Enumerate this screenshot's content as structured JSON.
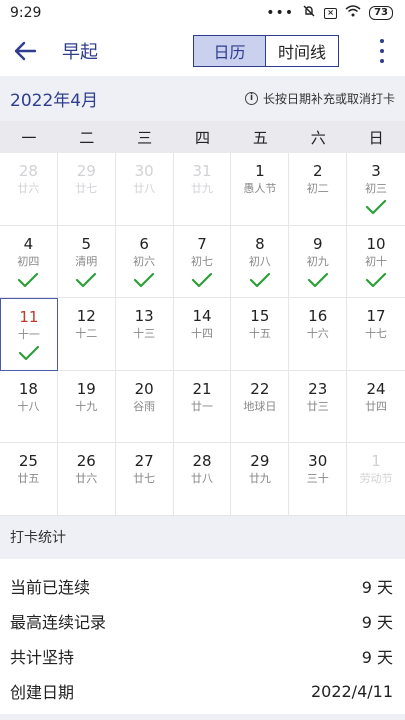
{
  "status": {
    "time": "9:29",
    "battery": "73"
  },
  "toolbar": {
    "title": "早起",
    "tab_calendar": "日历",
    "tab_timeline": "时间线"
  },
  "month": {
    "label": "2022年4月",
    "hint": "长按日期补充或取消打卡"
  },
  "weekdays": [
    "一",
    "二",
    "三",
    "四",
    "五",
    "六",
    "日"
  ],
  "days": [
    {
      "d": "28",
      "l": "廿六",
      "muted": true
    },
    {
      "d": "29",
      "l": "廿七",
      "muted": true
    },
    {
      "d": "30",
      "l": "廿八",
      "muted": true
    },
    {
      "d": "31",
      "l": "廿九",
      "muted": true
    },
    {
      "d": "1",
      "l": "愚人节"
    },
    {
      "d": "2",
      "l": "初二"
    },
    {
      "d": "3",
      "l": "初三",
      "checked": true
    },
    {
      "d": "4",
      "l": "初四",
      "checked": true
    },
    {
      "d": "5",
      "l": "清明",
      "checked": true
    },
    {
      "d": "6",
      "l": "初六",
      "checked": true
    },
    {
      "d": "7",
      "l": "初七",
      "checked": true
    },
    {
      "d": "8",
      "l": "初八",
      "checked": true
    },
    {
      "d": "9",
      "l": "初九",
      "checked": true
    },
    {
      "d": "10",
      "l": "初十",
      "checked": true
    },
    {
      "d": "11",
      "l": "十一",
      "checked": true,
      "today": true
    },
    {
      "d": "12",
      "l": "十二"
    },
    {
      "d": "13",
      "l": "十三"
    },
    {
      "d": "14",
      "l": "十四"
    },
    {
      "d": "15",
      "l": "十五"
    },
    {
      "d": "16",
      "l": "十六"
    },
    {
      "d": "17",
      "l": "十七"
    },
    {
      "d": "18",
      "l": "十八"
    },
    {
      "d": "19",
      "l": "十九"
    },
    {
      "d": "20",
      "l": "谷雨"
    },
    {
      "d": "21",
      "l": "廿一"
    },
    {
      "d": "22",
      "l": "地球日"
    },
    {
      "d": "23",
      "l": "廿三"
    },
    {
      "d": "24",
      "l": "廿四"
    },
    {
      "d": "25",
      "l": "廿五"
    },
    {
      "d": "26",
      "l": "廿六"
    },
    {
      "d": "27",
      "l": "廿七"
    },
    {
      "d": "28",
      "l": "廿八"
    },
    {
      "d": "29",
      "l": "廿九"
    },
    {
      "d": "30",
      "l": "三十"
    },
    {
      "d": "1",
      "l": "劳动节",
      "muted": true
    }
  ],
  "stats": {
    "header": "打卡统计",
    "rows": [
      {
        "label": "当前已连续",
        "value": "9 天"
      },
      {
        "label": "最高连续记录",
        "value": "9 天"
      },
      {
        "label": "共计坚持",
        "value": "9 天"
      },
      {
        "label": "创建日期",
        "value": "2022/4/11"
      }
    ]
  },
  "colors": {
    "accent": "#2f3d8f",
    "check": "#2e9e3a",
    "today": "#c0392b"
  }
}
